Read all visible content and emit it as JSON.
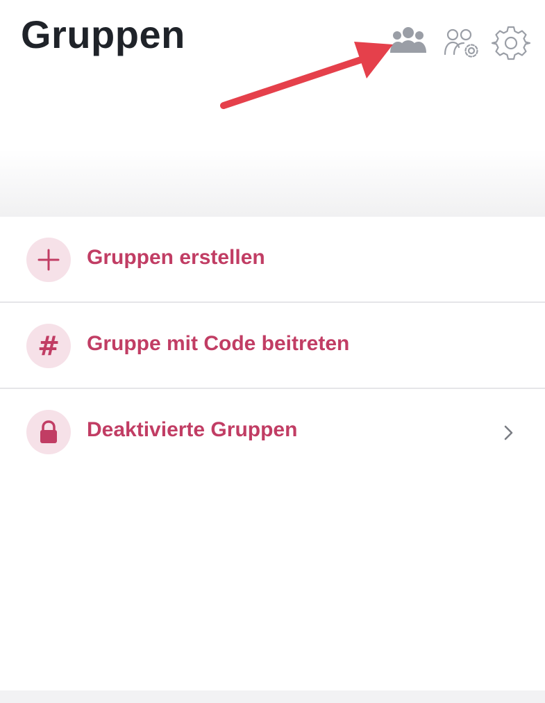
{
  "header": {
    "title": "Gruppen",
    "icons": [
      "groups-icon",
      "group-settings-icon",
      "gear-icon"
    ]
  },
  "menu": {
    "items": [
      {
        "label": "Gruppen erstellen",
        "icon": "plus-icon"
      },
      {
        "label": "Gruppe mit Code beitreten",
        "icon": "hash-icon",
        "glyph": "#"
      },
      {
        "label": "Deaktivierte Gruppen",
        "icon": "lock-icon",
        "trailing_icon": "chevron-right-icon"
      }
    ]
  },
  "colors": {
    "title": "#1f2329",
    "accent": "#c13d64",
    "icon_bg": "#f6e1e8",
    "header_icon": "#9a9ea6",
    "annotation_arrow": "#e5404b",
    "chevron": "#7a7d84"
  }
}
